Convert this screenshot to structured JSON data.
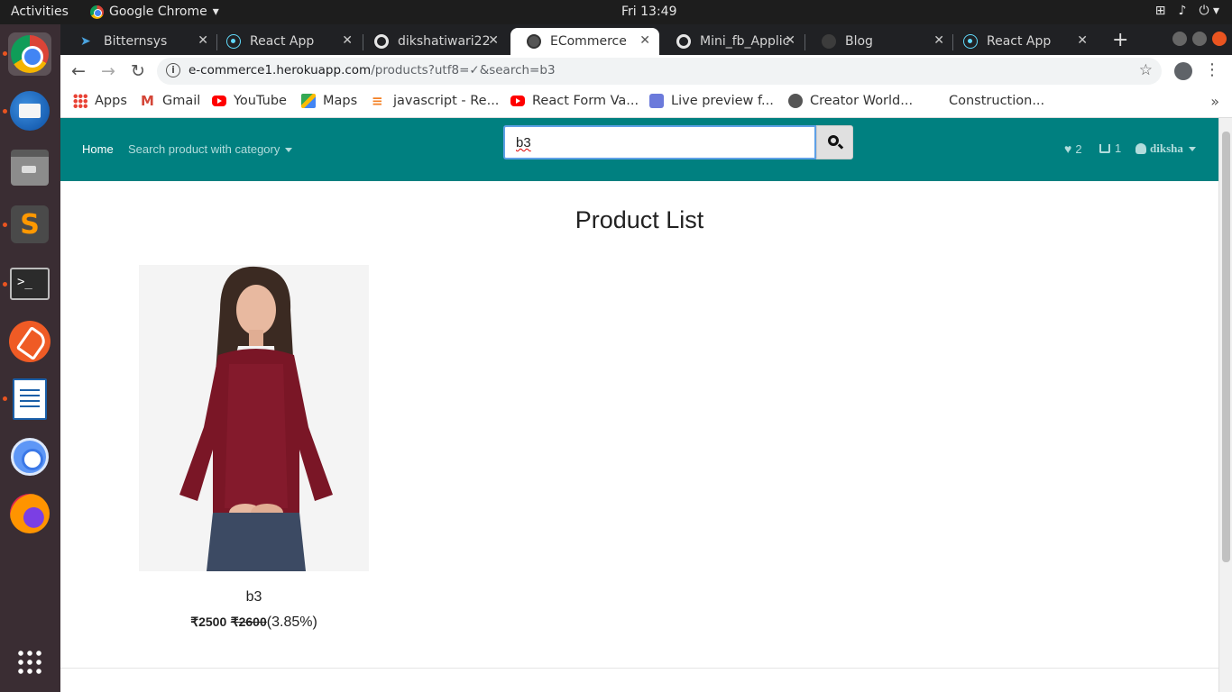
{
  "os": {
    "activities": "Activities",
    "app_menu": "Google Chrome",
    "clock": "Fri 13:49"
  },
  "tabs": [
    {
      "label": "Bitternsys",
      "icon": "bird-icon"
    },
    {
      "label": "React App",
      "icon": "react-icon"
    },
    {
      "label": "dikshatiwari22",
      "icon": "github-icon"
    },
    {
      "label": "ECommerce",
      "icon": "globe-icon",
      "active": true
    },
    {
      "label": "Mini_fb_Applic",
      "icon": "github-icon"
    },
    {
      "label": "Blog",
      "icon": "blog-icon"
    },
    {
      "label": "React App",
      "icon": "react-icon"
    }
  ],
  "address_bar": {
    "host": "e-commerce1.herokuapp.com",
    "path": "/products?utf8=✓&search=b3"
  },
  "bookmarks": [
    {
      "label": "Apps"
    },
    {
      "label": "Gmail"
    },
    {
      "label": "YouTube"
    },
    {
      "label": "Maps"
    },
    {
      "label": "javascript - Re..."
    },
    {
      "label": "React Form Va..."
    },
    {
      "label": "Live preview f..."
    },
    {
      "label": "Creator World..."
    },
    {
      "label": "Construction..."
    }
  ],
  "site": {
    "nav": {
      "home": "Home",
      "category": "Search product with category",
      "search_value": "b3",
      "wishlist_count": "2",
      "cart_count": "1",
      "user": "diksha"
    },
    "page_title": "Product List",
    "products": [
      {
        "name": "b3",
        "price": "₹2500",
        "original_price": "₹2600",
        "discount": "(3.85%)"
      }
    ]
  },
  "colors": {
    "navbar": "#008080",
    "dock": "#3a2d33",
    "accent": "#e95420"
  }
}
